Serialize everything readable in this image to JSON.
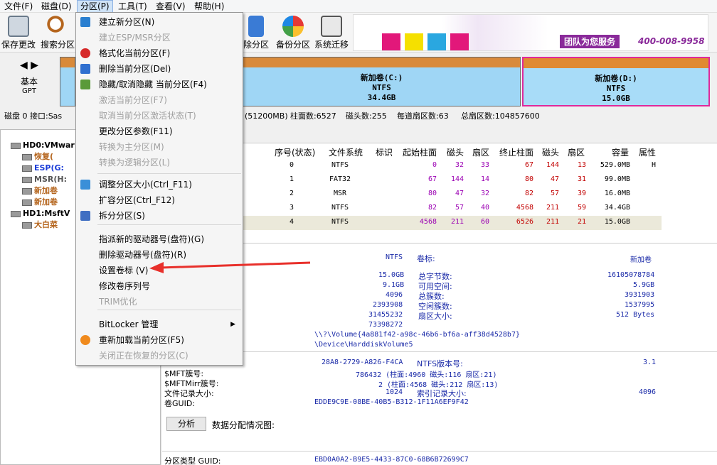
{
  "menubar": [
    "文件(F)",
    "磁盘(D)",
    "分区(P)",
    "工具(T)",
    "查看(V)",
    "帮助(H)"
  ],
  "toolbar": [
    "保存更改",
    "搜索分区",
    "除分区",
    "备份分区",
    "系统迁移"
  ],
  "banner": {
    "line1": "团队为您服务",
    "phone": "400-008-9958"
  },
  "disk_left": {
    "title": "基本",
    "sub": "GPT"
  },
  "partitions_bar": {
    "c": {
      "name": "新加卷(C:)",
      "fs": "NTFS",
      "size": "34.4GB"
    },
    "d": {
      "name": "新加卷(D:)",
      "fs": "NTFS",
      "size": "15.0GB"
    }
  },
  "diskline": {
    "disk": "磁盘 0 接口:Sas",
    "capacity": "(51200MB)",
    "cyl": "柱面数:6527",
    "heads": "磁头数:255",
    "spt": "每道扇区数:63",
    "total": "总扇区数:104857600"
  },
  "tree": {
    "hd0": "HD0:VMwar",
    "items": [
      "恢复(",
      "ESP(G:",
      "MSR(H:",
      "新加卷",
      "新加卷"
    ],
    "hd1": "HD1:MsftV",
    "hd1_items": [
      "大白菜"
    ]
  },
  "table": {
    "headers": [
      "序号(状态)",
      "文件系统",
      "标识",
      "起始柱面",
      "磁头",
      "扇区",
      "终止柱面",
      "磁头",
      "扇区",
      "容量",
      "属性"
    ],
    "rows": [
      [
        "0",
        "NTFS",
        "",
        "0",
        "32",
        "33",
        "67",
        "144",
        "13",
        "529.0MB",
        "H"
      ],
      [
        "1",
        "FAT32",
        "",
        "67",
        "144",
        "14",
        "80",
        "47",
        "31",
        "99.0MB",
        ""
      ],
      [
        "2",
        "MSR",
        "",
        "80",
        "47",
        "32",
        "82",
        "57",
        "39",
        "16.0MB",
        ""
      ],
      [
        "3",
        "NTFS",
        "",
        "82",
        "57",
        "40",
        "4568",
        "211",
        "59",
        "34.4GB",
        ""
      ],
      [
        "4",
        "NTFS",
        "",
        "4568",
        "211",
        "60",
        "6526",
        "211",
        "21",
        "15.0GB",
        ""
      ]
    ]
  },
  "detail": {
    "fs_value": "NTFS",
    "label_label": "卷标:",
    "label_value": "新加卷",
    "left_values": [
      "15.0GB",
      "9.1GB",
      "4096",
      "2393908",
      "31455232",
      "73398272"
    ],
    "mid_labels": [
      "总字节数:",
      "可用空间:",
      "总簇数:",
      "空闲簇数:",
      "扇区大小:"
    ],
    "right_values": [
      "16105078784",
      "5.9GB",
      "3931903",
      "1537995",
      "512 Bytes"
    ],
    "volume_path": "\\\\?\\Volume{4a881f42-a98c-46b6-bf6a-aff38d4528b7}",
    "device_path": "\\Device\\HarddiskVolume5",
    "serial": "28A8-2729-A826-F4CA",
    "ntfs_ver_label": "NTFS版本号:",
    "ntfs_ver": "3.1",
    "mft_label": "$MFT簇号:",
    "mft_value": "786432 (柱面:4960 磁头:116 扇区:21)",
    "mftmirr_label": "$MFTMirr簇号:",
    "mftmirr_value": "2 (柱面:4568 磁头:212 扇区:13)",
    "rec_label": "文件记录大小:",
    "rec_value": "1024",
    "idx_label": "索引记录大小:",
    "idx_value": "4096",
    "guid_label": "卷GUID:",
    "guid_value": "EDDE9C9E-08BE-40B5-B312-1F11A6EF9F42",
    "analyze": "分析",
    "alloc_label": "数据分配情况图:",
    "ptype_label": "分区类型 GUID:",
    "ptype_value": "EBD0A0A2-B9E5-4433-87C0-68B6B72699C7"
  },
  "dropdown": {
    "items": [
      {
        "label": "建立新分区(N)",
        "disabled": false,
        "icon": "new-partition-icon"
      },
      {
        "label": "建立ESP/MSR分区",
        "disabled": true,
        "icon": ""
      },
      {
        "label": "格式化当前分区(F)",
        "disabled": false,
        "icon": "format-icon"
      },
      {
        "label": "删除当前分区(Del)",
        "disabled": false,
        "icon": "delete-icon"
      },
      {
        "label": "隐藏/取消隐藏 当前分区(F4)",
        "disabled": false,
        "icon": "hide-icon"
      },
      {
        "label": "激活当前分区(F7)",
        "disabled": true,
        "icon": ""
      },
      {
        "label": "取消当前分区激活状态(T)",
        "disabled": true,
        "icon": ""
      },
      {
        "label": "更改分区参数(F11)",
        "disabled": false,
        "icon": ""
      },
      {
        "label": "转换为主分区(M)",
        "disabled": true,
        "icon": ""
      },
      {
        "label": "转换为逻辑分区(L)",
        "disabled": true,
        "icon": ""
      },
      {
        "label": "调整分区大小(Ctrl_F11)",
        "disabled": false,
        "icon": "resize-icon"
      },
      {
        "label": "扩容分区(Ctrl_F12)",
        "disabled": false,
        "icon": ""
      },
      {
        "label": "拆分分区(S)",
        "disabled": false,
        "icon": "split-icon"
      },
      {
        "label": "指派新的驱动器号(盘符)(G)",
        "disabled": false,
        "icon": ""
      },
      {
        "label": "删除驱动器号(盘符)(R)",
        "disabled": false,
        "icon": ""
      },
      {
        "label": "设置卷标 (V)",
        "disabled": false,
        "icon": ""
      },
      {
        "label": "修改卷序列号",
        "disabled": false,
        "icon": ""
      },
      {
        "label": "TRIM优化",
        "disabled": true,
        "icon": ""
      },
      {
        "label": "BitLocker 管理",
        "disabled": false,
        "icon": ""
      },
      {
        "label": "重新加载当前分区(F5)",
        "disabled": false,
        "icon": "reload-icon"
      },
      {
        "label": "关闭正在恢复的分区(C)",
        "disabled": true,
        "icon": ""
      }
    ]
  }
}
